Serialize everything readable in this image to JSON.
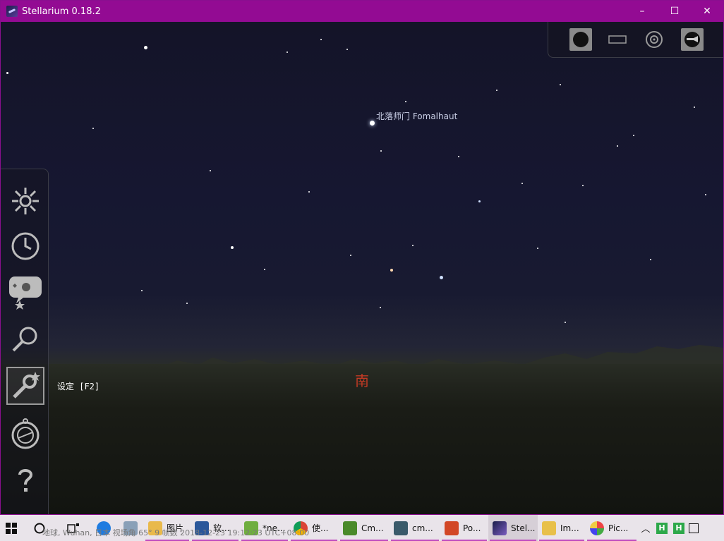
{
  "window": {
    "title": "Stellarium 0.18.2",
    "controls": {
      "minimize": "–",
      "maximize": "☐",
      "close": "✕"
    },
    "accent": "#930b93"
  },
  "sky": {
    "star_label": "北落师门 Fomalhaut",
    "cardinal": "南"
  },
  "topbar": {
    "buttons": [
      "fullscreen-toggle",
      "window-mode",
      "target",
      "quit"
    ]
  },
  "leftbar": {
    "buttons": [
      "location",
      "date-time",
      "sky-viewing-options",
      "search",
      "settings",
      "help-compass",
      "help"
    ],
    "active": "settings",
    "tooltip": "设定  [F2]"
  },
  "statusbar": {
    "text": "地球, Wuhan, 日本      视场角 65°       9 帧数  2018-12-23 19:12:23 UTC+08:00"
  },
  "taskbar": {
    "items": [
      {
        "label": "",
        "icon": "windows-start-icon"
      },
      {
        "label": "",
        "icon": "cortana-search-icon"
      },
      {
        "label": "",
        "icon": "task-view-icon"
      },
      {
        "label": "",
        "icon": "sogou-icon"
      },
      {
        "label": "",
        "icon": "photos-icon"
      },
      {
        "label": "图片",
        "icon": "folder-icon"
      },
      {
        "label": "软...",
        "icon": "word-icon"
      },
      {
        "label": "*ne...",
        "icon": "notepad-icon"
      },
      {
        "label": "使...",
        "icon": "chrome-icon"
      },
      {
        "label": "Cm...",
        "icon": "cmd-icon"
      },
      {
        "label": "cm...",
        "icon": "terminal-icon"
      },
      {
        "label": "Po...",
        "icon": "powerpoint-icon"
      },
      {
        "label": "Stel...",
        "icon": "stellarium-icon"
      },
      {
        "label": "Im...",
        "icon": "image-icon"
      },
      {
        "label": "Pic...",
        "icon": "paint-icon"
      }
    ],
    "tray": [
      "chevron-up-icon",
      "h-green-icon",
      "h-green-icon",
      "network-icon"
    ]
  }
}
